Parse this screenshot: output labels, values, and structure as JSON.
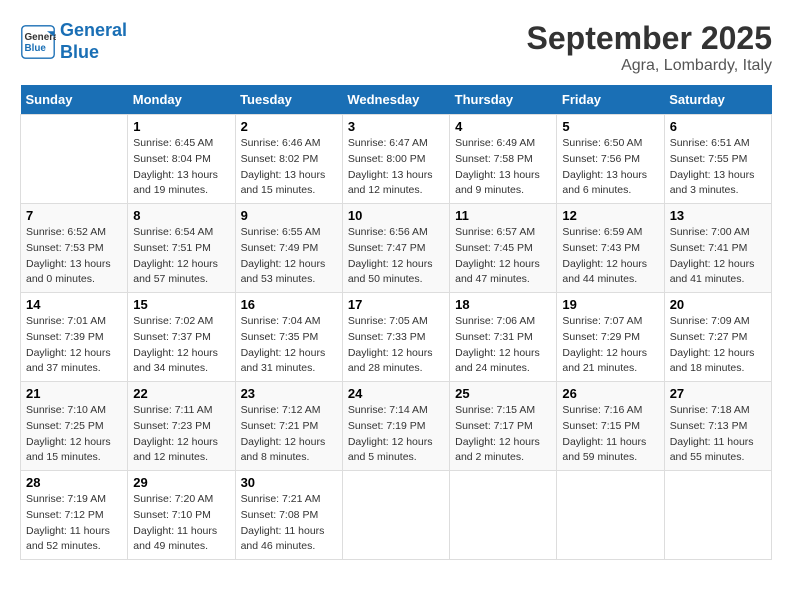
{
  "header": {
    "logo_line1": "General",
    "logo_line2": "Blue",
    "month_year": "September 2025",
    "location": "Agra, Lombardy, Italy"
  },
  "days_of_week": [
    "Sunday",
    "Monday",
    "Tuesday",
    "Wednesday",
    "Thursday",
    "Friday",
    "Saturday"
  ],
  "weeks": [
    [
      {
        "day": "",
        "info": ""
      },
      {
        "day": "1",
        "info": "Sunrise: 6:45 AM\nSunset: 8:04 PM\nDaylight: 13 hours\nand 19 minutes."
      },
      {
        "day": "2",
        "info": "Sunrise: 6:46 AM\nSunset: 8:02 PM\nDaylight: 13 hours\nand 15 minutes."
      },
      {
        "day": "3",
        "info": "Sunrise: 6:47 AM\nSunset: 8:00 PM\nDaylight: 13 hours\nand 12 minutes."
      },
      {
        "day": "4",
        "info": "Sunrise: 6:49 AM\nSunset: 7:58 PM\nDaylight: 13 hours\nand 9 minutes."
      },
      {
        "day": "5",
        "info": "Sunrise: 6:50 AM\nSunset: 7:56 PM\nDaylight: 13 hours\nand 6 minutes."
      },
      {
        "day": "6",
        "info": "Sunrise: 6:51 AM\nSunset: 7:55 PM\nDaylight: 13 hours\nand 3 minutes."
      }
    ],
    [
      {
        "day": "7",
        "info": "Sunrise: 6:52 AM\nSunset: 7:53 PM\nDaylight: 13 hours\nand 0 minutes."
      },
      {
        "day": "8",
        "info": "Sunrise: 6:54 AM\nSunset: 7:51 PM\nDaylight: 12 hours\nand 57 minutes."
      },
      {
        "day": "9",
        "info": "Sunrise: 6:55 AM\nSunset: 7:49 PM\nDaylight: 12 hours\nand 53 minutes."
      },
      {
        "day": "10",
        "info": "Sunrise: 6:56 AM\nSunset: 7:47 PM\nDaylight: 12 hours\nand 50 minutes."
      },
      {
        "day": "11",
        "info": "Sunrise: 6:57 AM\nSunset: 7:45 PM\nDaylight: 12 hours\nand 47 minutes."
      },
      {
        "day": "12",
        "info": "Sunrise: 6:59 AM\nSunset: 7:43 PM\nDaylight: 12 hours\nand 44 minutes."
      },
      {
        "day": "13",
        "info": "Sunrise: 7:00 AM\nSunset: 7:41 PM\nDaylight: 12 hours\nand 41 minutes."
      }
    ],
    [
      {
        "day": "14",
        "info": "Sunrise: 7:01 AM\nSunset: 7:39 PM\nDaylight: 12 hours\nand 37 minutes."
      },
      {
        "day": "15",
        "info": "Sunrise: 7:02 AM\nSunset: 7:37 PM\nDaylight: 12 hours\nand 34 minutes."
      },
      {
        "day": "16",
        "info": "Sunrise: 7:04 AM\nSunset: 7:35 PM\nDaylight: 12 hours\nand 31 minutes."
      },
      {
        "day": "17",
        "info": "Sunrise: 7:05 AM\nSunset: 7:33 PM\nDaylight: 12 hours\nand 28 minutes."
      },
      {
        "day": "18",
        "info": "Sunrise: 7:06 AM\nSunset: 7:31 PM\nDaylight: 12 hours\nand 24 minutes."
      },
      {
        "day": "19",
        "info": "Sunrise: 7:07 AM\nSunset: 7:29 PM\nDaylight: 12 hours\nand 21 minutes."
      },
      {
        "day": "20",
        "info": "Sunrise: 7:09 AM\nSunset: 7:27 PM\nDaylight: 12 hours\nand 18 minutes."
      }
    ],
    [
      {
        "day": "21",
        "info": "Sunrise: 7:10 AM\nSunset: 7:25 PM\nDaylight: 12 hours\nand 15 minutes."
      },
      {
        "day": "22",
        "info": "Sunrise: 7:11 AM\nSunset: 7:23 PM\nDaylight: 12 hours\nand 12 minutes."
      },
      {
        "day": "23",
        "info": "Sunrise: 7:12 AM\nSunset: 7:21 PM\nDaylight: 12 hours\nand 8 minutes."
      },
      {
        "day": "24",
        "info": "Sunrise: 7:14 AM\nSunset: 7:19 PM\nDaylight: 12 hours\nand 5 minutes."
      },
      {
        "day": "25",
        "info": "Sunrise: 7:15 AM\nSunset: 7:17 PM\nDaylight: 12 hours\nand 2 minutes."
      },
      {
        "day": "26",
        "info": "Sunrise: 7:16 AM\nSunset: 7:15 PM\nDaylight: 11 hours\nand 59 minutes."
      },
      {
        "day": "27",
        "info": "Sunrise: 7:18 AM\nSunset: 7:13 PM\nDaylight: 11 hours\nand 55 minutes."
      }
    ],
    [
      {
        "day": "28",
        "info": "Sunrise: 7:19 AM\nSunset: 7:12 PM\nDaylight: 11 hours\nand 52 minutes."
      },
      {
        "day": "29",
        "info": "Sunrise: 7:20 AM\nSunset: 7:10 PM\nDaylight: 11 hours\nand 49 minutes."
      },
      {
        "day": "30",
        "info": "Sunrise: 7:21 AM\nSunset: 7:08 PM\nDaylight: 11 hours\nand 46 minutes."
      },
      {
        "day": "",
        "info": ""
      },
      {
        "day": "",
        "info": ""
      },
      {
        "day": "",
        "info": ""
      },
      {
        "day": "",
        "info": ""
      }
    ]
  ]
}
